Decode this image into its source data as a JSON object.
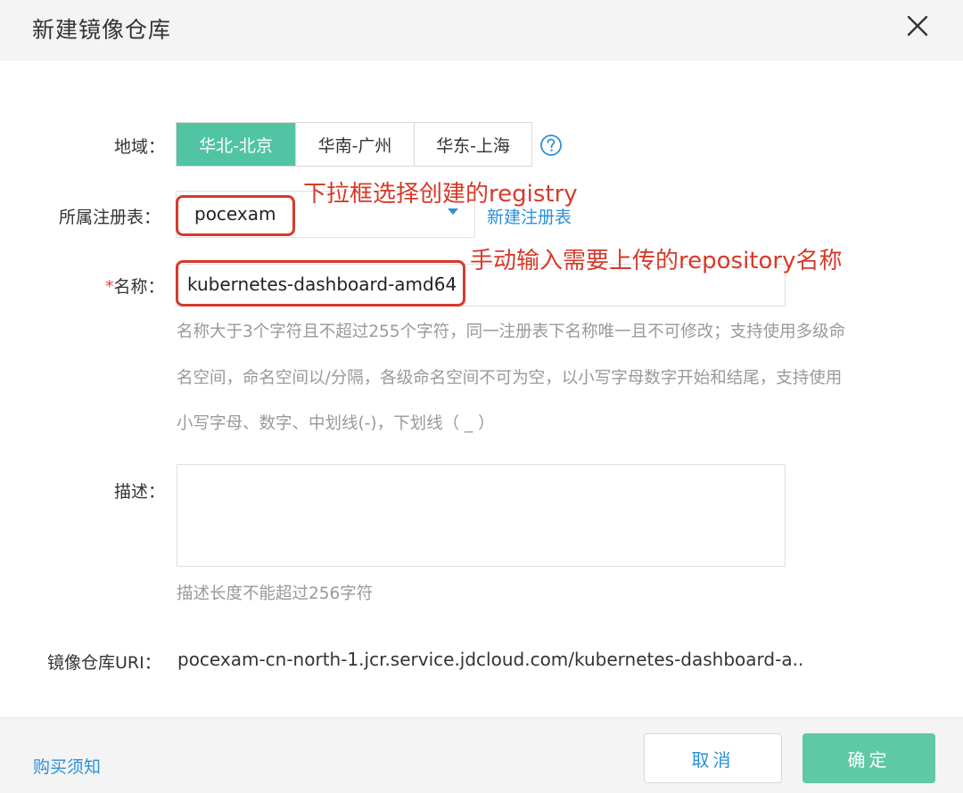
{
  "dialog": {
    "title": "新建镜像仓库"
  },
  "form": {
    "region": {
      "label": "地域：",
      "options": [
        "华北-北京",
        "华南-广州",
        "华东-上海"
      ],
      "selected": "华北-北京"
    },
    "registry": {
      "label": "所属注册表：",
      "value": "pocexam",
      "new_link": "新建注册表"
    },
    "name": {
      "required_mark": "*",
      "label": "名称：",
      "value": "kubernetes-dashboard-amd64",
      "hint_lines": [
        "名称大于3个字符且不超过255个字符，同一注册表下名称唯一且不可修改；支持使用多级命",
        "名空间，命名空间以/分隔，各级命名空间不可为空，以小写字母数字开始和结尾，支持使用",
        "小写字母、数字、中划线(-)，下划线（ _ ）"
      ]
    },
    "description": {
      "label": "描述：",
      "value": "",
      "hint": "描述长度不能超过256字符"
    },
    "uri": {
      "label": "镜像仓库URI：",
      "value": "pocexam-cn-north-1.jcr.service.jdcloud.com/kubernetes-dashboard-a..."
    }
  },
  "footer": {
    "purchase_link": "购买须知",
    "cancel_label": "取消",
    "confirm_label": "确定"
  },
  "annotations": {
    "registry_note": "下拉框选择创建的registry",
    "name_note": "手动输入需要上传的repository名称"
  },
  "colors": {
    "accent_green": "#51c4a4",
    "link_blue": "#2b90d9",
    "annotation_red": "#d63a2a"
  },
  "icons": {
    "close": "close-icon",
    "help": "help-circle-icon",
    "caret": "caret-down-icon"
  }
}
